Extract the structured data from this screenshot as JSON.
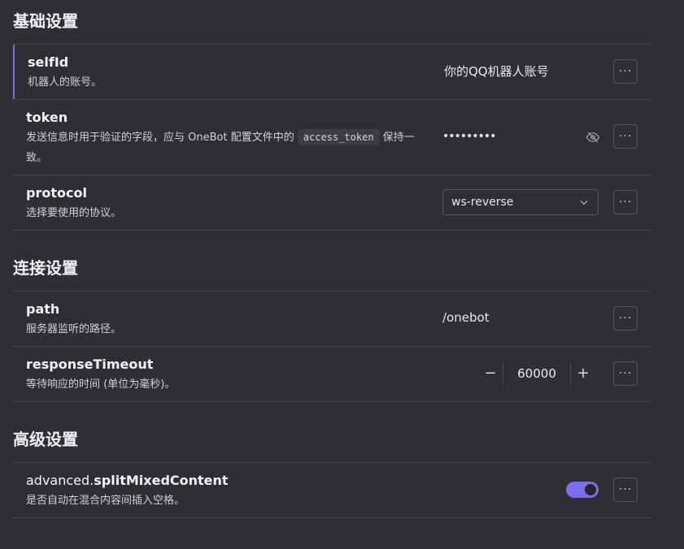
{
  "sections": [
    {
      "title": "基础设置",
      "rows": [
        {
          "key": "selfId",
          "desc": "机器人的账号。",
          "value": "你的QQ机器人账号"
        },
        {
          "key": "token",
          "desc_before": "发送信息时用于验证的字段，应与 OneBot 配置文件中的 ",
          "desc_code": "access_token",
          "desc_after": " 保持一致。",
          "value_masked": "•••••••••"
        },
        {
          "key": "protocol",
          "desc": "选择要使用的协议。",
          "selected": "ws-reverse"
        }
      ]
    },
    {
      "title": "连接设置",
      "rows": [
        {
          "key": "path",
          "desc": "服务器监听的路径。",
          "value": "/onebot"
        },
        {
          "key": "responseTimeout",
          "desc": "等待响应的时间 (单位为毫秒)。",
          "value": "60000",
          "minus": "−",
          "plus": "+"
        }
      ]
    },
    {
      "title": "高级设置",
      "rows": [
        {
          "key_prefix": "advanced.",
          "key": "splitMixedContent",
          "desc": "是否自动在混合内容间插入空格。",
          "toggle_on": true
        }
      ]
    }
  ],
  "more_label": "···",
  "icons": {
    "more": "more-dots-icon",
    "visibility": "eye-off-icon",
    "dropdown": "chevron-down-icon"
  },
  "colors": {
    "background": "#2f2f33",
    "accent": "#7c6cf2",
    "border": "#55555c",
    "divider": "#44444a"
  }
}
